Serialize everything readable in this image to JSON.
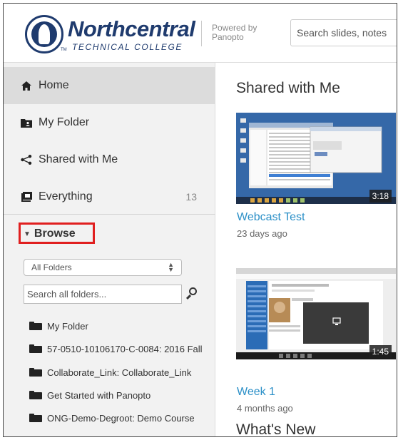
{
  "header": {
    "logo_name": "Northcentral",
    "logo_sub": "TECHNICAL COLLEGE",
    "logo_tm": "TM",
    "powered_by": "Powered by\nPanopto",
    "search_placeholder": "Search slides, notes"
  },
  "sidebar": {
    "nav": [
      {
        "label": "Home",
        "icon": "home-icon",
        "active": true
      },
      {
        "label": "My Folder",
        "icon": "my-folder-icon"
      },
      {
        "label": "Shared with Me",
        "icon": "share-icon"
      },
      {
        "label": "Everything",
        "icon": "everything-icon",
        "count": "13"
      }
    ],
    "browse_label": "Browse",
    "folder_select": "All Folders",
    "folder_search_placeholder": "Search all folders...",
    "folders": [
      "My Folder",
      "57-0510-10106170-C-0084: 2016 Fall",
      "Collaborate_Link: Collaborate_Link",
      "Get Started with Panopto",
      "ONG-Demo-Degroot: Demo Course"
    ]
  },
  "main": {
    "shared_title": "Shared with Me",
    "sessions": [
      {
        "title": "Webcast Test",
        "date": "23 days ago",
        "duration": "3:18"
      },
      {
        "title": "Week 1",
        "date": "4 months ago",
        "duration": "1:45"
      }
    ],
    "whats_new_title": "What's New"
  },
  "colors": {
    "brand": "#1f3b6e",
    "link": "#2a8fc7",
    "highlight_box": "#e01f1f",
    "sidebar_bg": "#f2f2f2",
    "active_bg": "#dcdcdc"
  }
}
